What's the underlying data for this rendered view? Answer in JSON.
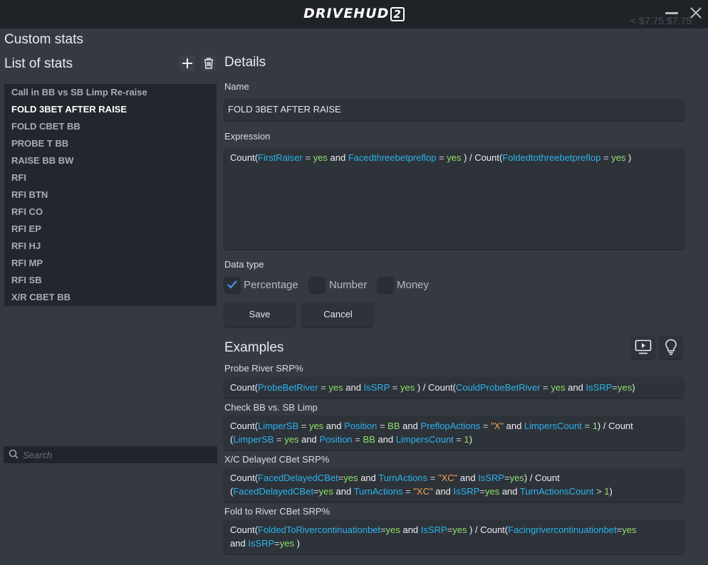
{
  "titlebar": {
    "logo_main": "DRIVEHUD",
    "logo_version": "2",
    "faint_text": "<  $7.75  $7.75"
  },
  "page": {
    "title": "Custom stats",
    "list_title": "List of stats",
    "details_title": "Details",
    "examples_title": "Examples"
  },
  "stats": [
    {
      "label": "Call in BB vs SB Limp Re-raise",
      "selected": false
    },
    {
      "label": "FOLD 3BET AFTER RAISE",
      "selected": true
    },
    {
      "label": "FOLD CBET BB",
      "selected": false
    },
    {
      "label": "PROBE T BB",
      "selected": false
    },
    {
      "label": "RAISE BB BW",
      "selected": false
    },
    {
      "label": "RFI",
      "selected": false
    },
    {
      "label": "RFI BTN",
      "selected": false
    },
    {
      "label": "RFI CO",
      "selected": false
    },
    {
      "label": "RFI EP",
      "selected": false
    },
    {
      "label": "RFI HJ",
      "selected": false
    },
    {
      "label": "RFI MP",
      "selected": false
    },
    {
      "label": "RFI SB",
      "selected": false
    },
    {
      "label": "X/R CBET BB",
      "selected": false
    }
  ],
  "search": {
    "placeholder": "Search",
    "value": ""
  },
  "details": {
    "name_label": "Name",
    "name_value": "FOLD 3BET AFTER RAISE",
    "expression_label": "Expression",
    "expression_tokens": [
      [
        "kw",
        "Count("
      ],
      [
        "var",
        "FirstRaiser"
      ],
      [
        "op",
        " = "
      ],
      [
        "val",
        "yes"
      ],
      [
        "kw",
        " and "
      ],
      [
        "var",
        "Facedthreebetpreflop"
      ],
      [
        "op",
        " = "
      ],
      [
        "val",
        "yes"
      ],
      [
        "kw",
        " ) / Count("
      ],
      [
        "var",
        "Foldedtothreebetpreflop"
      ],
      [
        "op",
        " = "
      ],
      [
        "val",
        "yes"
      ],
      [
        "kw",
        " )"
      ]
    ],
    "data_type_label": "Data type",
    "data_types": [
      {
        "label": "Percentage",
        "checked": true
      },
      {
        "label": "Number",
        "checked": false
      },
      {
        "label": "Money",
        "checked": false
      }
    ],
    "save_label": "Save",
    "cancel_label": "Cancel"
  },
  "examples": [
    {
      "title": "Probe River SRP%",
      "tokens": [
        [
          "kw",
          "Count("
        ],
        [
          "var",
          "ProbeBetRiver"
        ],
        [
          "op",
          " = "
        ],
        [
          "val",
          "yes"
        ],
        [
          "kw",
          " and "
        ],
        [
          "var",
          "IsSRP"
        ],
        [
          "op",
          " = "
        ],
        [
          "val",
          "yes"
        ],
        [
          "kw",
          " ) / Count("
        ],
        [
          "var",
          "CouldProbeBetRiver"
        ],
        [
          "op",
          " = "
        ],
        [
          "val",
          "yes"
        ],
        [
          "kw",
          " and "
        ],
        [
          "var",
          "IsSRP"
        ],
        [
          "op",
          "="
        ],
        [
          "val",
          "yes"
        ],
        [
          "kw",
          ")"
        ]
      ]
    },
    {
      "title": "Check BB vs. SB Limp",
      "tokens": [
        [
          "kw",
          "Count("
        ],
        [
          "var",
          "LimperSB"
        ],
        [
          "op",
          " = "
        ],
        [
          "val",
          "yes"
        ],
        [
          "kw",
          " and "
        ],
        [
          "var",
          "Position"
        ],
        [
          "op",
          " = "
        ],
        [
          "val",
          "BB"
        ],
        [
          "kw",
          " and "
        ],
        [
          "var",
          "PreflopActions"
        ],
        [
          "op",
          " = "
        ],
        [
          "str",
          "\"X\""
        ],
        [
          "kw",
          " and "
        ],
        [
          "var",
          "LimpersCount"
        ],
        [
          "op",
          " = "
        ],
        [
          "num",
          "1"
        ],
        [
          "kw",
          ") / Count"
        ],
        [
          "br",
          ""
        ],
        [
          "kw",
          "("
        ],
        [
          "var",
          "LimperSB"
        ],
        [
          "op",
          " = "
        ],
        [
          "val",
          "yes"
        ],
        [
          "kw",
          " and "
        ],
        [
          "var",
          "Position"
        ],
        [
          "op",
          " = "
        ],
        [
          "val",
          "BB"
        ],
        [
          "kw",
          " and "
        ],
        [
          "var",
          "LimpersCount"
        ],
        [
          "op",
          " = "
        ],
        [
          "num",
          "1"
        ],
        [
          "kw",
          ")"
        ]
      ]
    },
    {
      "title": "X/C Delayed CBet SRP%",
      "tokens": [
        [
          "kw",
          "Count("
        ],
        [
          "var",
          "FacedDelayedCBet"
        ],
        [
          "op",
          "="
        ],
        [
          "val",
          "yes"
        ],
        [
          "kw",
          " and "
        ],
        [
          "var",
          "TurnActions"
        ],
        [
          "op",
          " = "
        ],
        [
          "str",
          "\"XC\""
        ],
        [
          "kw",
          " and "
        ],
        [
          "var",
          "IsSRP"
        ],
        [
          "op",
          "="
        ],
        [
          "val",
          "yes"
        ],
        [
          "kw",
          ") / Count"
        ],
        [
          "br",
          ""
        ],
        [
          "kw",
          "("
        ],
        [
          "var",
          "FacedDelayedCBet"
        ],
        [
          "op",
          "="
        ],
        [
          "val",
          "yes"
        ],
        [
          "kw",
          " and "
        ],
        [
          "var",
          "TurnActions"
        ],
        [
          "op",
          " = "
        ],
        [
          "str",
          "\"XC\""
        ],
        [
          "kw",
          " and "
        ],
        [
          "var",
          "IsSRP"
        ],
        [
          "op",
          "="
        ],
        [
          "val",
          "yes"
        ],
        [
          "kw",
          " and "
        ],
        [
          "var",
          "TurnActionsCount"
        ],
        [
          "op",
          " > "
        ],
        [
          "num",
          "1"
        ],
        [
          "kw",
          ")"
        ]
      ]
    },
    {
      "title": "Fold to River CBet SRP%",
      "tokens": [
        [
          "kw",
          "Count("
        ],
        [
          "var",
          "FoldedToRivercontinuationbet"
        ],
        [
          "op",
          "="
        ],
        [
          "val",
          "yes"
        ],
        [
          "kw",
          " and "
        ],
        [
          "var",
          "IsSRP"
        ],
        [
          "op",
          "="
        ],
        [
          "val",
          "yes"
        ],
        [
          "kw",
          " ) / Count("
        ],
        [
          "var",
          "Facingrivercontinuationbet"
        ],
        [
          "op",
          "="
        ],
        [
          "val",
          "yes"
        ],
        [
          "br",
          ""
        ],
        [
          "kw",
          "and "
        ],
        [
          "var",
          "IsSRP"
        ],
        [
          "op",
          "="
        ],
        [
          "val",
          "yes"
        ],
        [
          "kw",
          " )"
        ]
      ]
    }
  ]
}
